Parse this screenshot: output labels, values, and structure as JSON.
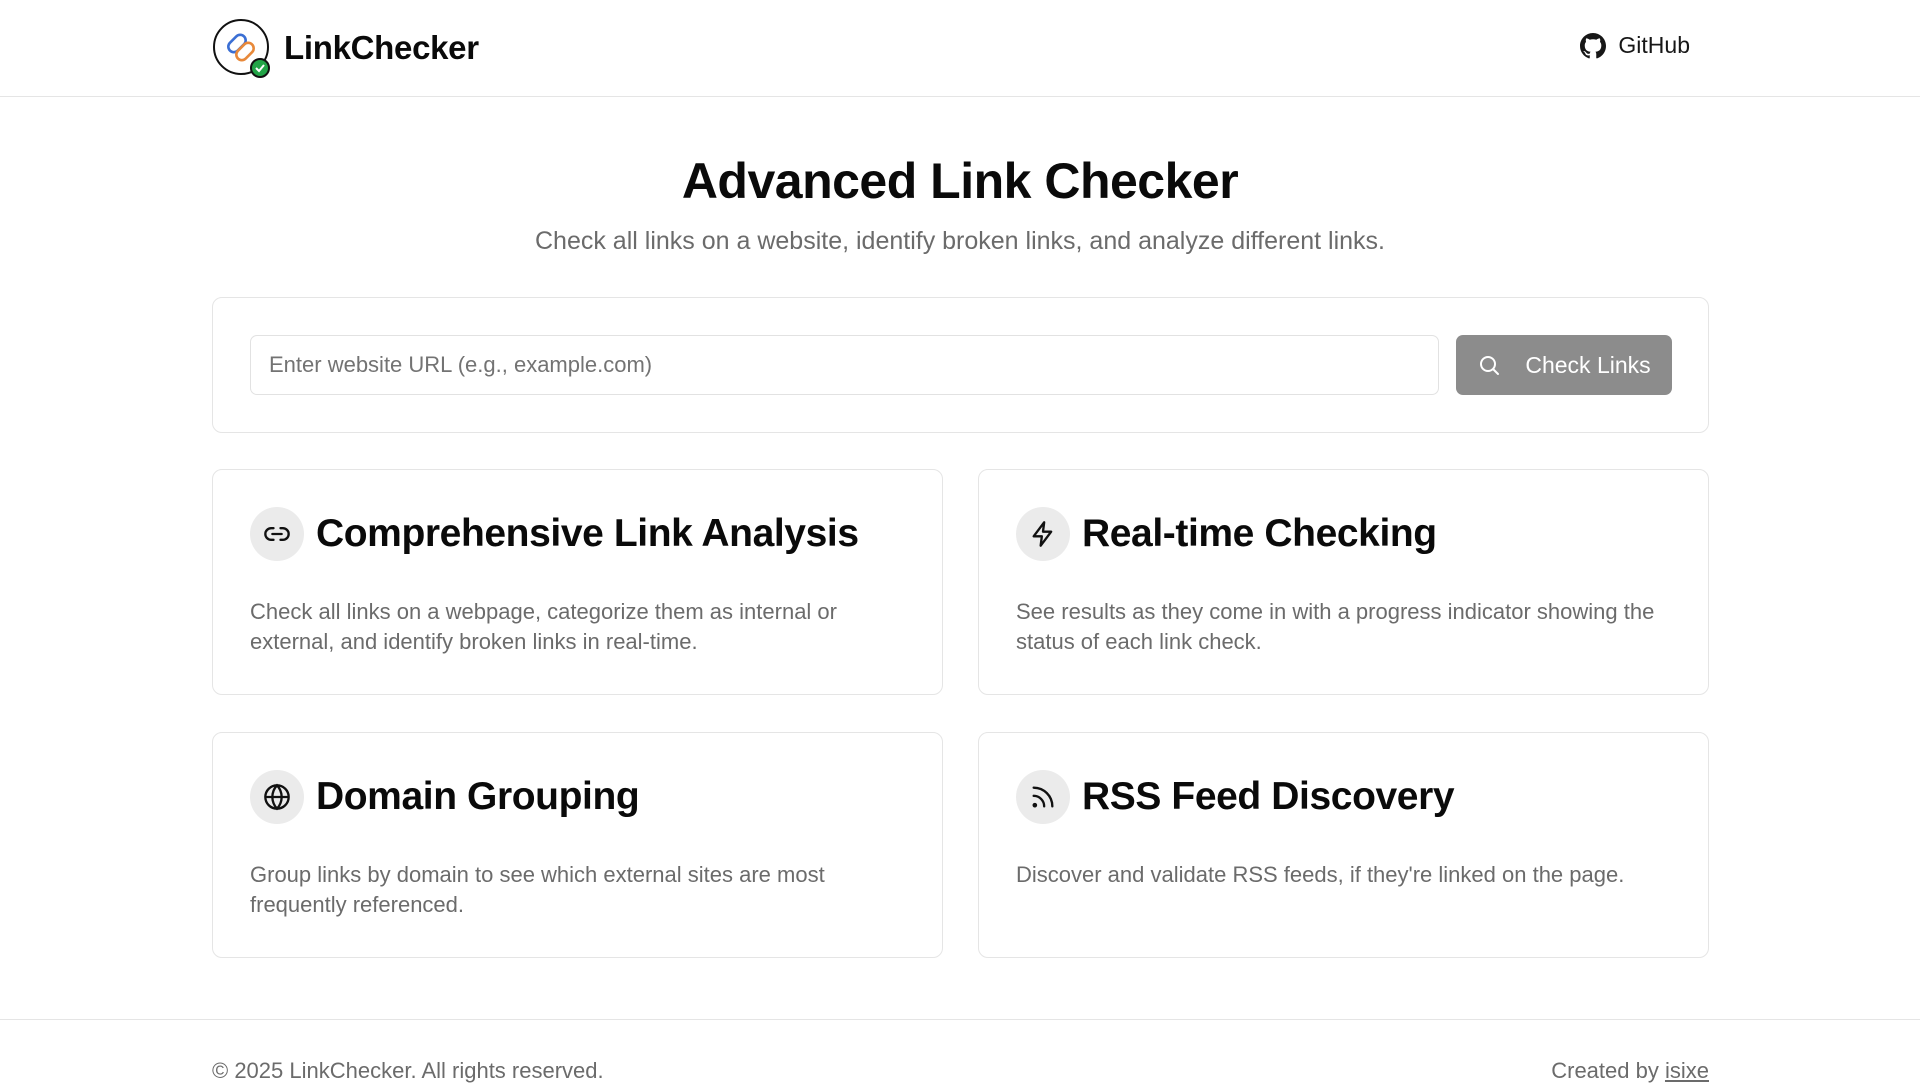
{
  "header": {
    "brand_name": "LinkChecker",
    "logo_icon": "chain-link-check-icon",
    "github_label": "GitHub",
    "github_icon": "github-icon"
  },
  "hero": {
    "title": "Advanced Link Checker",
    "subtitle": "Check all links on a website, identify broken links, and analyze different links."
  },
  "search": {
    "placeholder": "Enter website URL (e.g., example.com)",
    "value": "",
    "button_label": "Check Links",
    "button_icon": "search-icon"
  },
  "features": [
    {
      "icon": "link-icon",
      "title": "Comprehensive Link Analysis",
      "description": "Check all links on a webpage, categorize them as internal or external, and identify broken links in real-time."
    },
    {
      "icon": "lightning-icon",
      "title": "Real-time Checking",
      "description": "See results as they come in with a progress indicator showing the status of each link check."
    },
    {
      "icon": "globe-icon",
      "title": "Domain Grouping",
      "description": "Group links by domain to see which external sites are most frequently referenced."
    },
    {
      "icon": "rss-icon",
      "title": "RSS Feed Discovery",
      "description": "Discover and validate RSS feeds, if they're linked on the page."
    }
  ],
  "footer": {
    "copyright": "© 2025 LinkChecker. All rights reserved.",
    "credit_prefix": "Created by",
    "credit_author": "isixe"
  },
  "colors": {
    "button_bg": "#8c8c8c",
    "icon_circle_bg": "#ebebeb",
    "muted_text": "#6b6b6b",
    "border": "#e5e5e5",
    "logo_badge": "#22a447"
  }
}
